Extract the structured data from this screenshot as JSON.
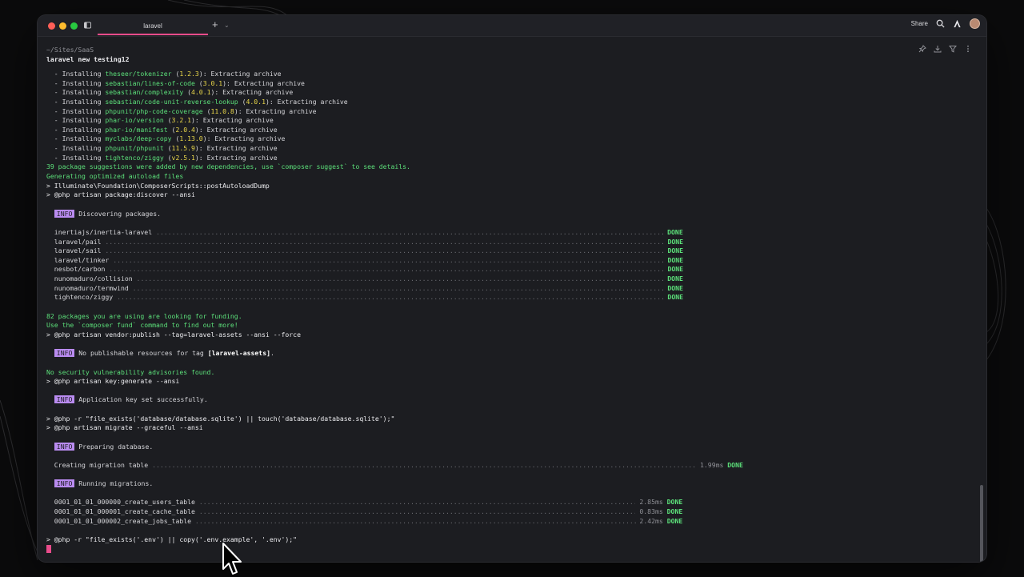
{
  "window": {
    "tab_label": "laravel",
    "share_label": "Share",
    "cwd": "~/Sites/SaaS",
    "command": "laravel new testing12"
  },
  "colors": {
    "accent": "#e94c8b",
    "success": "#5ce07a",
    "package": "#e8d64a",
    "info_badge": "#b98bf0"
  },
  "installs": [
    {
      "pkg": "theseer/tokenizer",
      "ver": "1.2.3"
    },
    {
      "pkg": "sebastian/lines-of-code",
      "ver": "3.0.1"
    },
    {
      "pkg": "sebastian/complexity",
      "ver": "4.0.1"
    },
    {
      "pkg": "sebastian/code-unit-reverse-lookup",
      "ver": "4.0.1"
    },
    {
      "pkg": "phpunit/php-code-coverage",
      "ver": "11.0.8"
    },
    {
      "pkg": "phar-io/version",
      "ver": "3.2.1"
    },
    {
      "pkg": "phar-io/manifest",
      "ver": "2.0.4"
    },
    {
      "pkg": "myclabs/deep-copy",
      "ver": "1.13.0"
    },
    {
      "pkg": "phpunit/phpunit",
      "ver": "11.5.9"
    },
    {
      "pkg": "tightenco/ziggy",
      "ver": "v2.5.1"
    }
  ],
  "install_prefix": "  - Installing ",
  "install_suffix": ": Extracting archive",
  "suggestions": "39 package suggestions were added by new dependencies, use `composer suggest` to see details.",
  "gen_autoload": "Generating optimized autoload files",
  "post_autoload": "> Illuminate\\Foundation\\ComposerScripts::postAutoloadDump",
  "pkg_discover_cmd": "> @php artisan package:discover --ansi",
  "info_label": "INFO",
  "discovering": "Discovering packages.",
  "done_label": "DONE",
  "discovered": [
    "inertiajs/inertia-laravel",
    "laravel/pail",
    "laravel/sail",
    "laravel/tinker",
    "nesbot/carbon",
    "nunomaduro/collision",
    "nunomaduro/termwind",
    "tightenco/ziggy"
  ],
  "funding_1": "82 packages you are using are looking for funding.",
  "funding_2": "Use the `composer fund` command to find out more!",
  "vendor_publish_cmd": "> @php artisan vendor:publish --tag=laravel-assets --ansi --force",
  "no_publishable_pre": "No publishable resources for tag ",
  "no_publishable_tag": "[laravel-assets]",
  "no_publishable_post": ".",
  "no_vuln": "No security vulnerability advisories found.",
  "keygen_cmd": "> @php artisan key:generate --ansi",
  "key_set": "Application key set successfully.",
  "sqlite_cmd": "> @php -r \"file_exists('database/database.sqlite') || touch('database/database.sqlite');\"",
  "migrate_cmd": "> @php artisan migrate --graceful --ansi",
  "preparing_db": "Preparing database.",
  "creating_table": "Creating migration table",
  "creating_table_ms": "1.99ms",
  "running_migrations": "Running migrations.",
  "migrations": [
    {
      "name": "0001_01_01_000000_create_users_table",
      "ms": "2.85ms"
    },
    {
      "name": "0001_01_01_000001_create_cache_table",
      "ms": "0.83ms"
    },
    {
      "name": "0001_01_01_000002_create_jobs_table",
      "ms": "2.42ms"
    }
  ],
  "env_cmd": "> @php -r \"file_exists('.env') || copy('.env.example', '.env');\""
}
